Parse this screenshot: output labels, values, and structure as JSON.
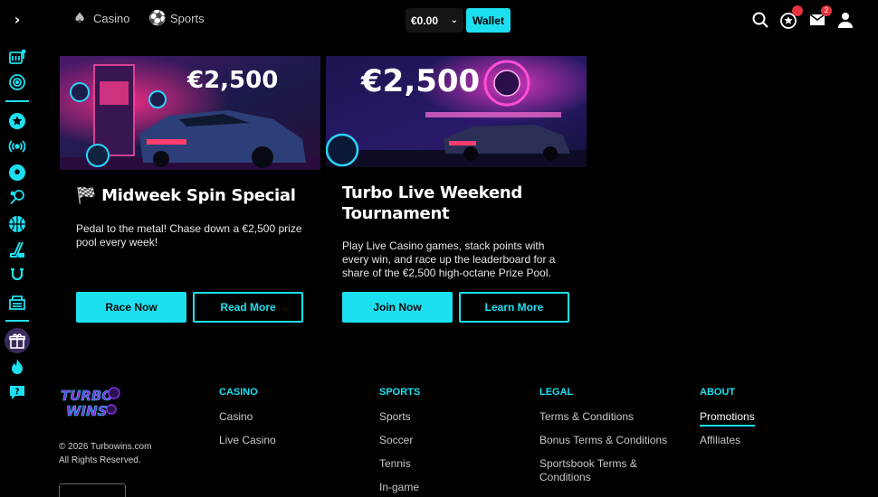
{
  "header": {
    "nav": [
      {
        "label": "Casino",
        "icon": "spade-icon"
      },
      {
        "label": "Sports",
        "icon": "soccer-ball-icon"
      }
    ],
    "balance": "€0.00",
    "wallet_label": "Wallet",
    "rewards_badge": "",
    "messages_badge": "2"
  },
  "sidebar": {
    "icons": [
      "casino-slot-icon",
      "live-roulette-icon",
      "favorites-star-icon",
      "live-broadcast-icon",
      "soccer-icon",
      "tennis-icon",
      "basketball-icon",
      "hockey-icon",
      "horseshoe-icon",
      "virtual-sports-icon",
      "gift-icon",
      "fire-icon",
      "help-chat-icon"
    ]
  },
  "promos": [
    {
      "amount": "€2,500",
      "title": "🏁 Midweek Spin Special",
      "description": "Pedal to the metal! Chase down a €2,500 prize pool every week!",
      "primary": "Race Now",
      "secondary": "Read More"
    },
    {
      "amount": "€2,500",
      "title": "Turbo Live Weekend Tournament",
      "description": "Play Live Casino games, stack points with every win, and race up the leaderboard for a share of the €2,500 high-octane Prize Pool.",
      "primary": "Join Now",
      "secondary": "Learn More"
    }
  ],
  "footer": {
    "logo": "TURBO WINS",
    "copyright": "© 2026 Turbowins.com",
    "rights": "All Rights Reserved.",
    "columns": [
      {
        "heading": "CASINO",
        "links": [
          "Casino",
          "Live Casino"
        ]
      },
      {
        "heading": "SPORTS",
        "links": [
          "Sports",
          "Soccer",
          "Tennis",
          "In-game"
        ]
      },
      {
        "heading": "LEGAL",
        "links": [
          "Terms & Conditions",
          "Bonus Terms & Conditions",
          "Sportsbook Terms & Conditions"
        ]
      },
      {
        "heading": "ABOUT",
        "links": [
          "Promotions",
          "Affiliates"
        ]
      }
    ]
  },
  "colors": {
    "accent": "#1ce0f0",
    "background": "#000000",
    "badge": "#e4333b"
  }
}
